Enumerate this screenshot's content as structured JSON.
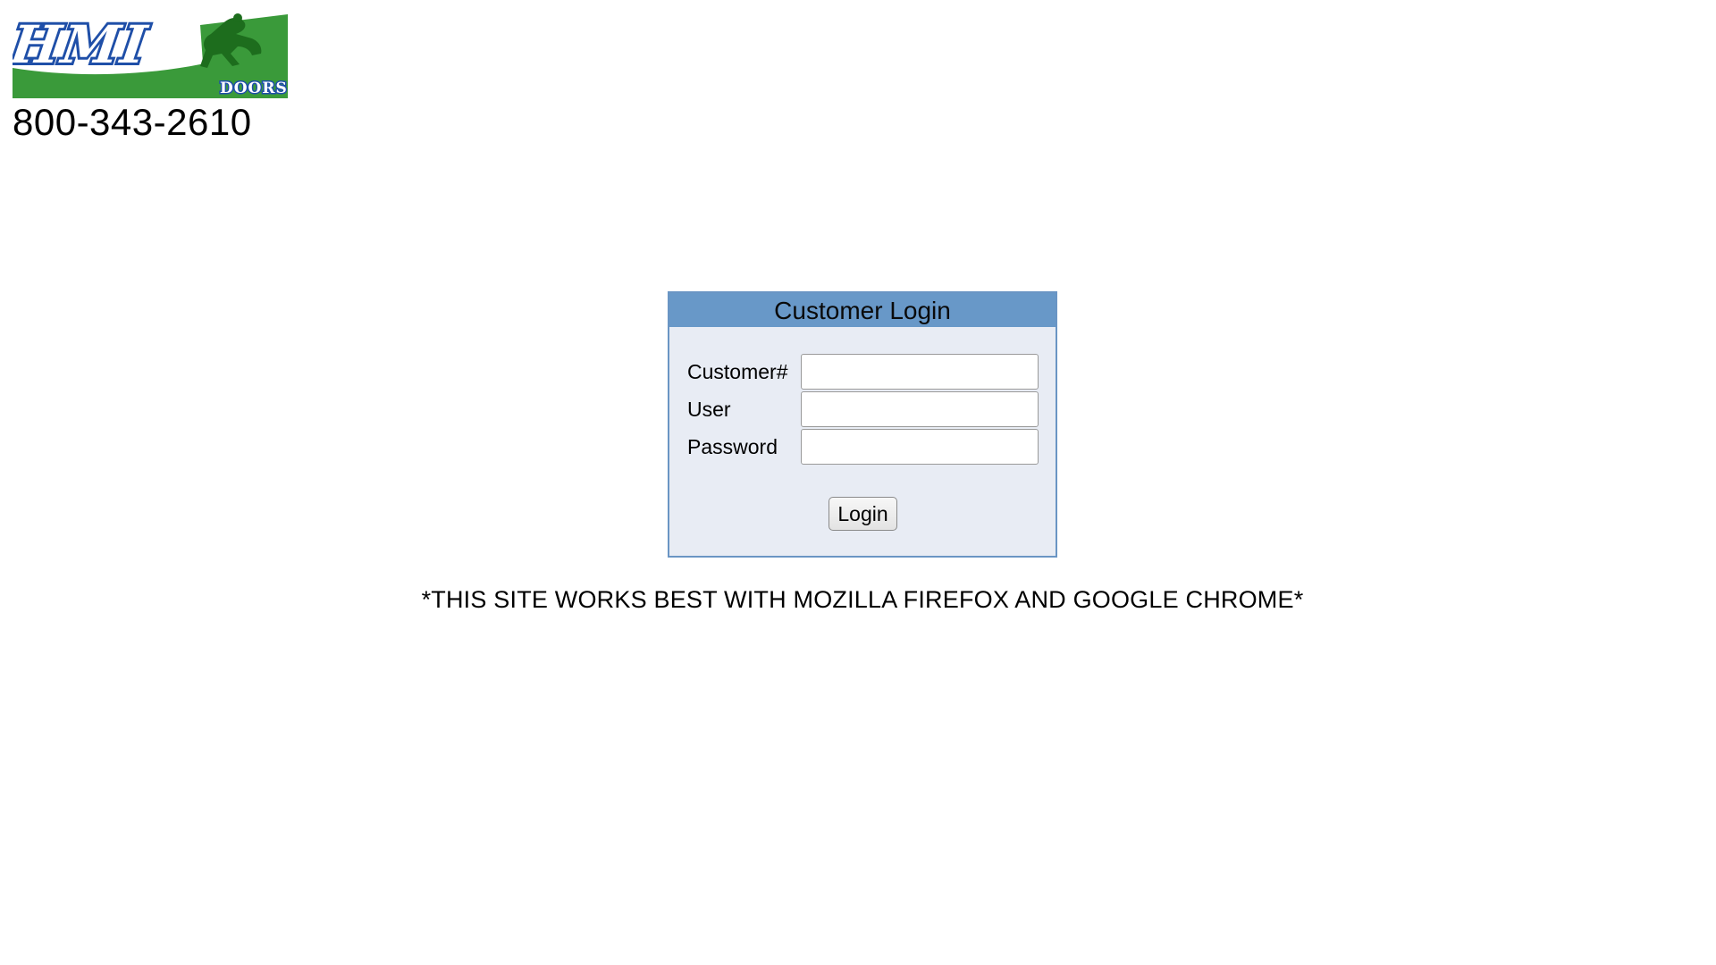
{
  "brand": {
    "logo_text": "HMI",
    "logo_subtext": "DOORS",
    "phone": "800-343-2610",
    "colors": {
      "logo_blue": "#1f4fa8",
      "logo_green": "#3a9a3a"
    }
  },
  "login": {
    "title": "Customer Login",
    "fields": [
      {
        "label": "Customer#",
        "value": "",
        "placeholder": ""
      },
      {
        "label": "User",
        "value": "",
        "placeholder": ""
      },
      {
        "label": "Password",
        "value": "",
        "placeholder": ""
      }
    ],
    "submit_label": "Login",
    "colors": {
      "header_bg": "#6898c8",
      "panel_bg": "#e8ecf4"
    }
  },
  "notice": "*THIS SITE WORKS BEST WITH MOZILLA FIREFOX AND GOOGLE CHROME*"
}
